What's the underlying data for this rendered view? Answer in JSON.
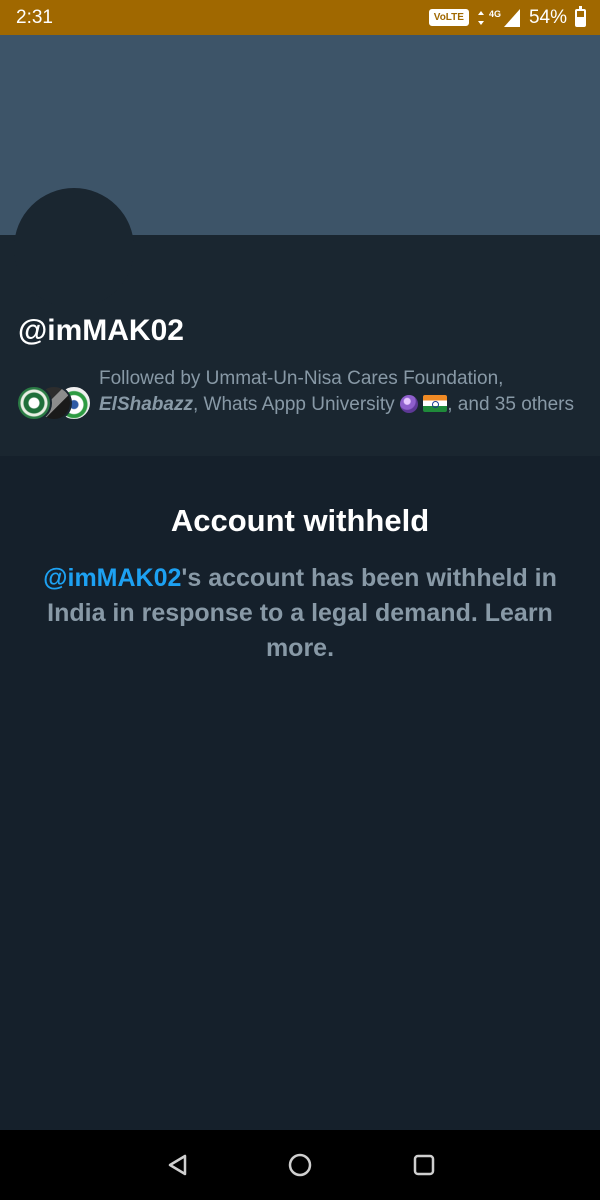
{
  "status_bar": {
    "time": "2:31",
    "volte": "VoLTE",
    "network": "4G",
    "battery_percent": "54%",
    "battery_level": 0.54,
    "color": "#a06800"
  },
  "profile": {
    "handle": "@imMAK02",
    "followed_by_prefix": "Followed by Ummat-Un-Nisa Cares Foundation,",
    "followed_by_name2": "ElShabazz",
    "followed_by_name3": ", Whats Appp University",
    "followed_by_suffix": ", and 35",
    "followed_by_end": "others"
  },
  "withheld": {
    "title": "Account withheld",
    "mention": "@imMAK02",
    "message": "'s account has been withheld in India in response to a legal demand.",
    "learn_more": "Learn more."
  },
  "colors": {
    "banner": "#3d5468",
    "background": "#15202b",
    "profile_bg": "#1a2630",
    "accent": "#1da1f2",
    "secondary_text": "#8899a6"
  },
  "icons": {
    "back": "back-triangle-icon",
    "home": "home-circle-icon",
    "recents": "recents-square-icon"
  }
}
